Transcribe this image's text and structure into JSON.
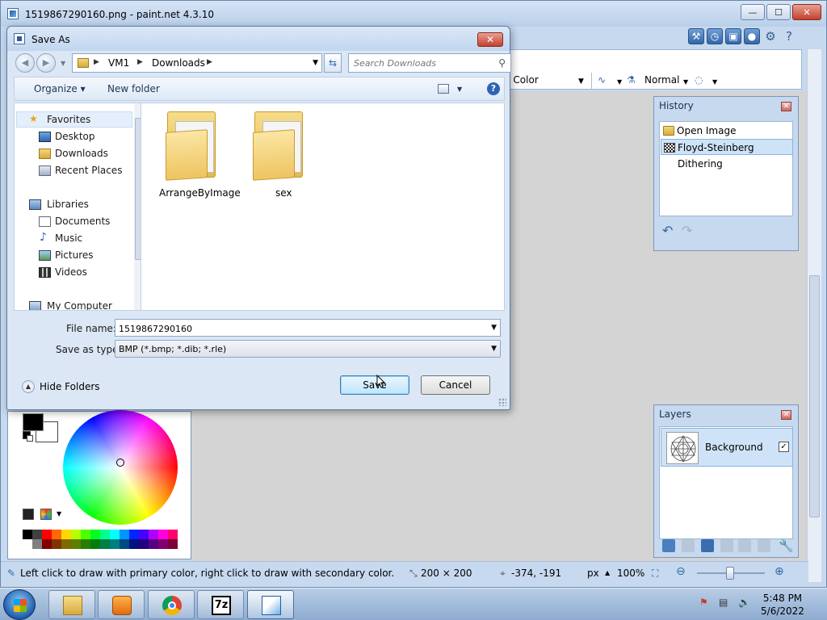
{
  "main_window": {
    "title": "1519867290160.png - paint.net 4.3.10",
    "caption_min": "—",
    "caption_max": "☐",
    "caption_close": "✕"
  },
  "toolbar": {
    "fill_label": "d Color",
    "blend_mode": "Normal"
  },
  "history": {
    "title": "History",
    "items": [
      {
        "label": "Open Image",
        "icon": "folder-open-icon"
      },
      {
        "label": "Floyd-Steinberg Dithering",
        "icon": "dither-icon"
      }
    ],
    "undo_glyph": "↶",
    "redo_glyph": "↷"
  },
  "layers": {
    "title": "Layers",
    "items": [
      {
        "label": "Background",
        "visible": "✓"
      }
    ]
  },
  "status_bar": {
    "hint": "Left click to draw with primary color, right click to draw with secondary color.",
    "image_size": "200 × 200",
    "cursor_pos": "-374, -191",
    "units": "px",
    "zoom": "100%"
  },
  "dialog": {
    "title": "Save As",
    "close_glyph": "✕",
    "breadcrumb": [
      "VM1",
      "Downloads"
    ],
    "search_placeholder": "Search Downloads",
    "organize_label": "Organize ▾",
    "new_folder_label": "New folder",
    "help_glyph": "?",
    "nav": {
      "favorites": "Favorites",
      "favorite_items": [
        "Desktop",
        "Downloads",
        "Recent Places"
      ],
      "libraries": "Libraries",
      "library_items": [
        "Documents",
        "Music",
        "Pictures",
        "Videos"
      ],
      "computer": "My Computer"
    },
    "files": [
      {
        "name": "ArrangeByImage"
      },
      {
        "name": "sex"
      }
    ],
    "file_name_label": "File name:",
    "file_name_value": "1519867290160",
    "save_type_label": "Save as type:",
    "save_type_value": "BMP (*.bmp; *.dib; *.rle)",
    "hide_folders_label": "Hide Folders",
    "save_label": "Save",
    "cancel_label": "Cancel"
  },
  "taskbar": {
    "time": "5:48 PM",
    "date": "5/6/2022",
    "seven_zip": "7z"
  },
  "colors": {
    "accent": "#3c7fb1",
    "title_bar": "#c1d6ef",
    "close_red": "#c4402c"
  }
}
